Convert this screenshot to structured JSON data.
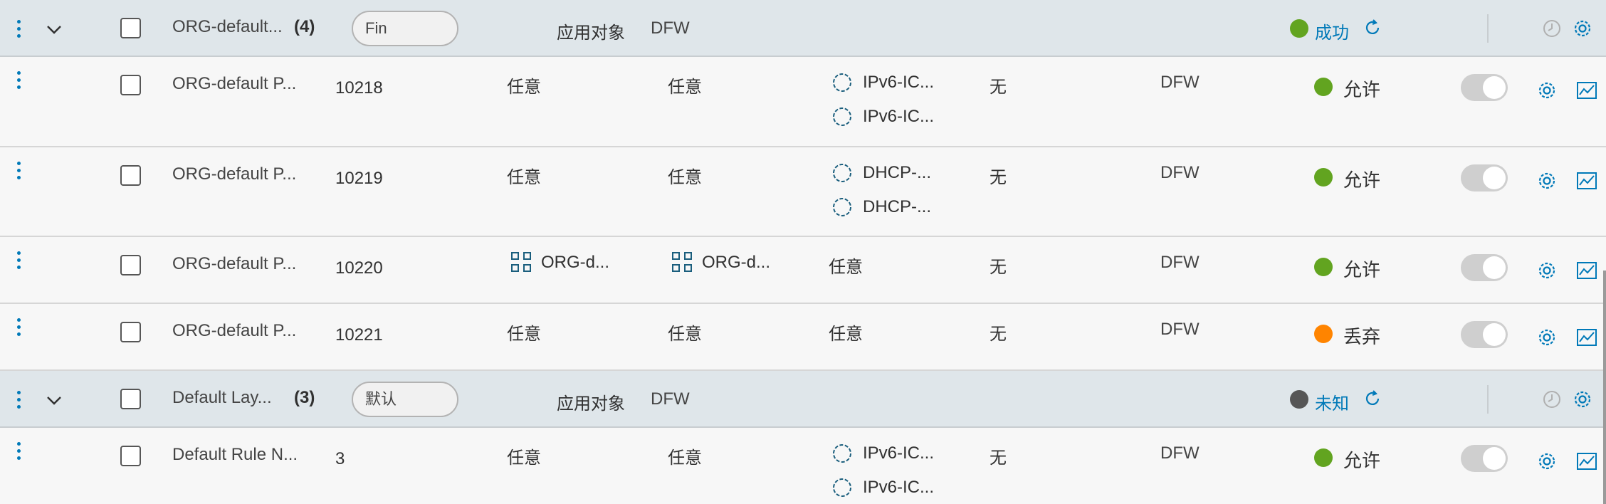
{
  "sections": [
    {
      "name": "ORG-default...",
      "count": "(4)",
      "category": "Fin",
      "applied_to": "应用对象",
      "applied_value": "DFW",
      "status": "成功",
      "status_color": "#62a420",
      "rows": [
        {
          "name": "ORG-default P...",
          "id": "10218",
          "sources": "任意",
          "destinations": "任意",
          "services": [
            "IPv6-IC...",
            "IPv6-IC..."
          ],
          "context": "无",
          "applied": "DFW",
          "action": "允许",
          "action_color": "#62a420"
        },
        {
          "name": "ORG-default P...",
          "id": "10219",
          "sources": "任意",
          "destinations": "任意",
          "services": [
            "DHCP-...",
            "DHCP-..."
          ],
          "context": "无",
          "applied": "DFW",
          "action": "允许",
          "action_color": "#62a420"
        },
        {
          "name": "ORG-default P...",
          "id": "10220",
          "sources": "ORG-d...",
          "destinations": "ORG-d...",
          "services": [
            "任意"
          ],
          "context": "无",
          "applied": "DFW",
          "action": "允许",
          "action_color": "#62a420"
        },
        {
          "name": "ORG-default P...",
          "id": "10221",
          "sources": "任意",
          "destinations": "任意",
          "services": [
            "任意"
          ],
          "context": "无",
          "applied": "DFW",
          "action": "丢弃",
          "action_color": "#ff8400"
        }
      ]
    },
    {
      "name": "Default Lay...",
      "count": "(3)",
      "category": "默认",
      "applied_to": "应用对象",
      "applied_value": "DFW",
      "status": "未知",
      "status_color": "#565656",
      "rows": [
        {
          "name": "Default Rule N...",
          "id": "3",
          "sources": "任意",
          "destinations": "任意",
          "services": [
            "IPv6-IC...",
            "IPv6-IC..."
          ],
          "context": "无",
          "applied": "DFW",
          "action": "允许",
          "action_color": "#62a420"
        }
      ]
    }
  ],
  "icons": {
    "menu": "kebab-icon",
    "expand": "chevron-down-icon",
    "service": "service-gear-icon",
    "group": "group-icon",
    "refresh": "refresh-icon",
    "history": "clock-icon",
    "settings": "gear-icon",
    "stats": "chart-icon"
  },
  "colors": {
    "accent": "#0079b8",
    "section_bg": "#dfe6ea",
    "allow": "#62a420",
    "drop": "#ff8400",
    "unknown": "#565656"
  }
}
